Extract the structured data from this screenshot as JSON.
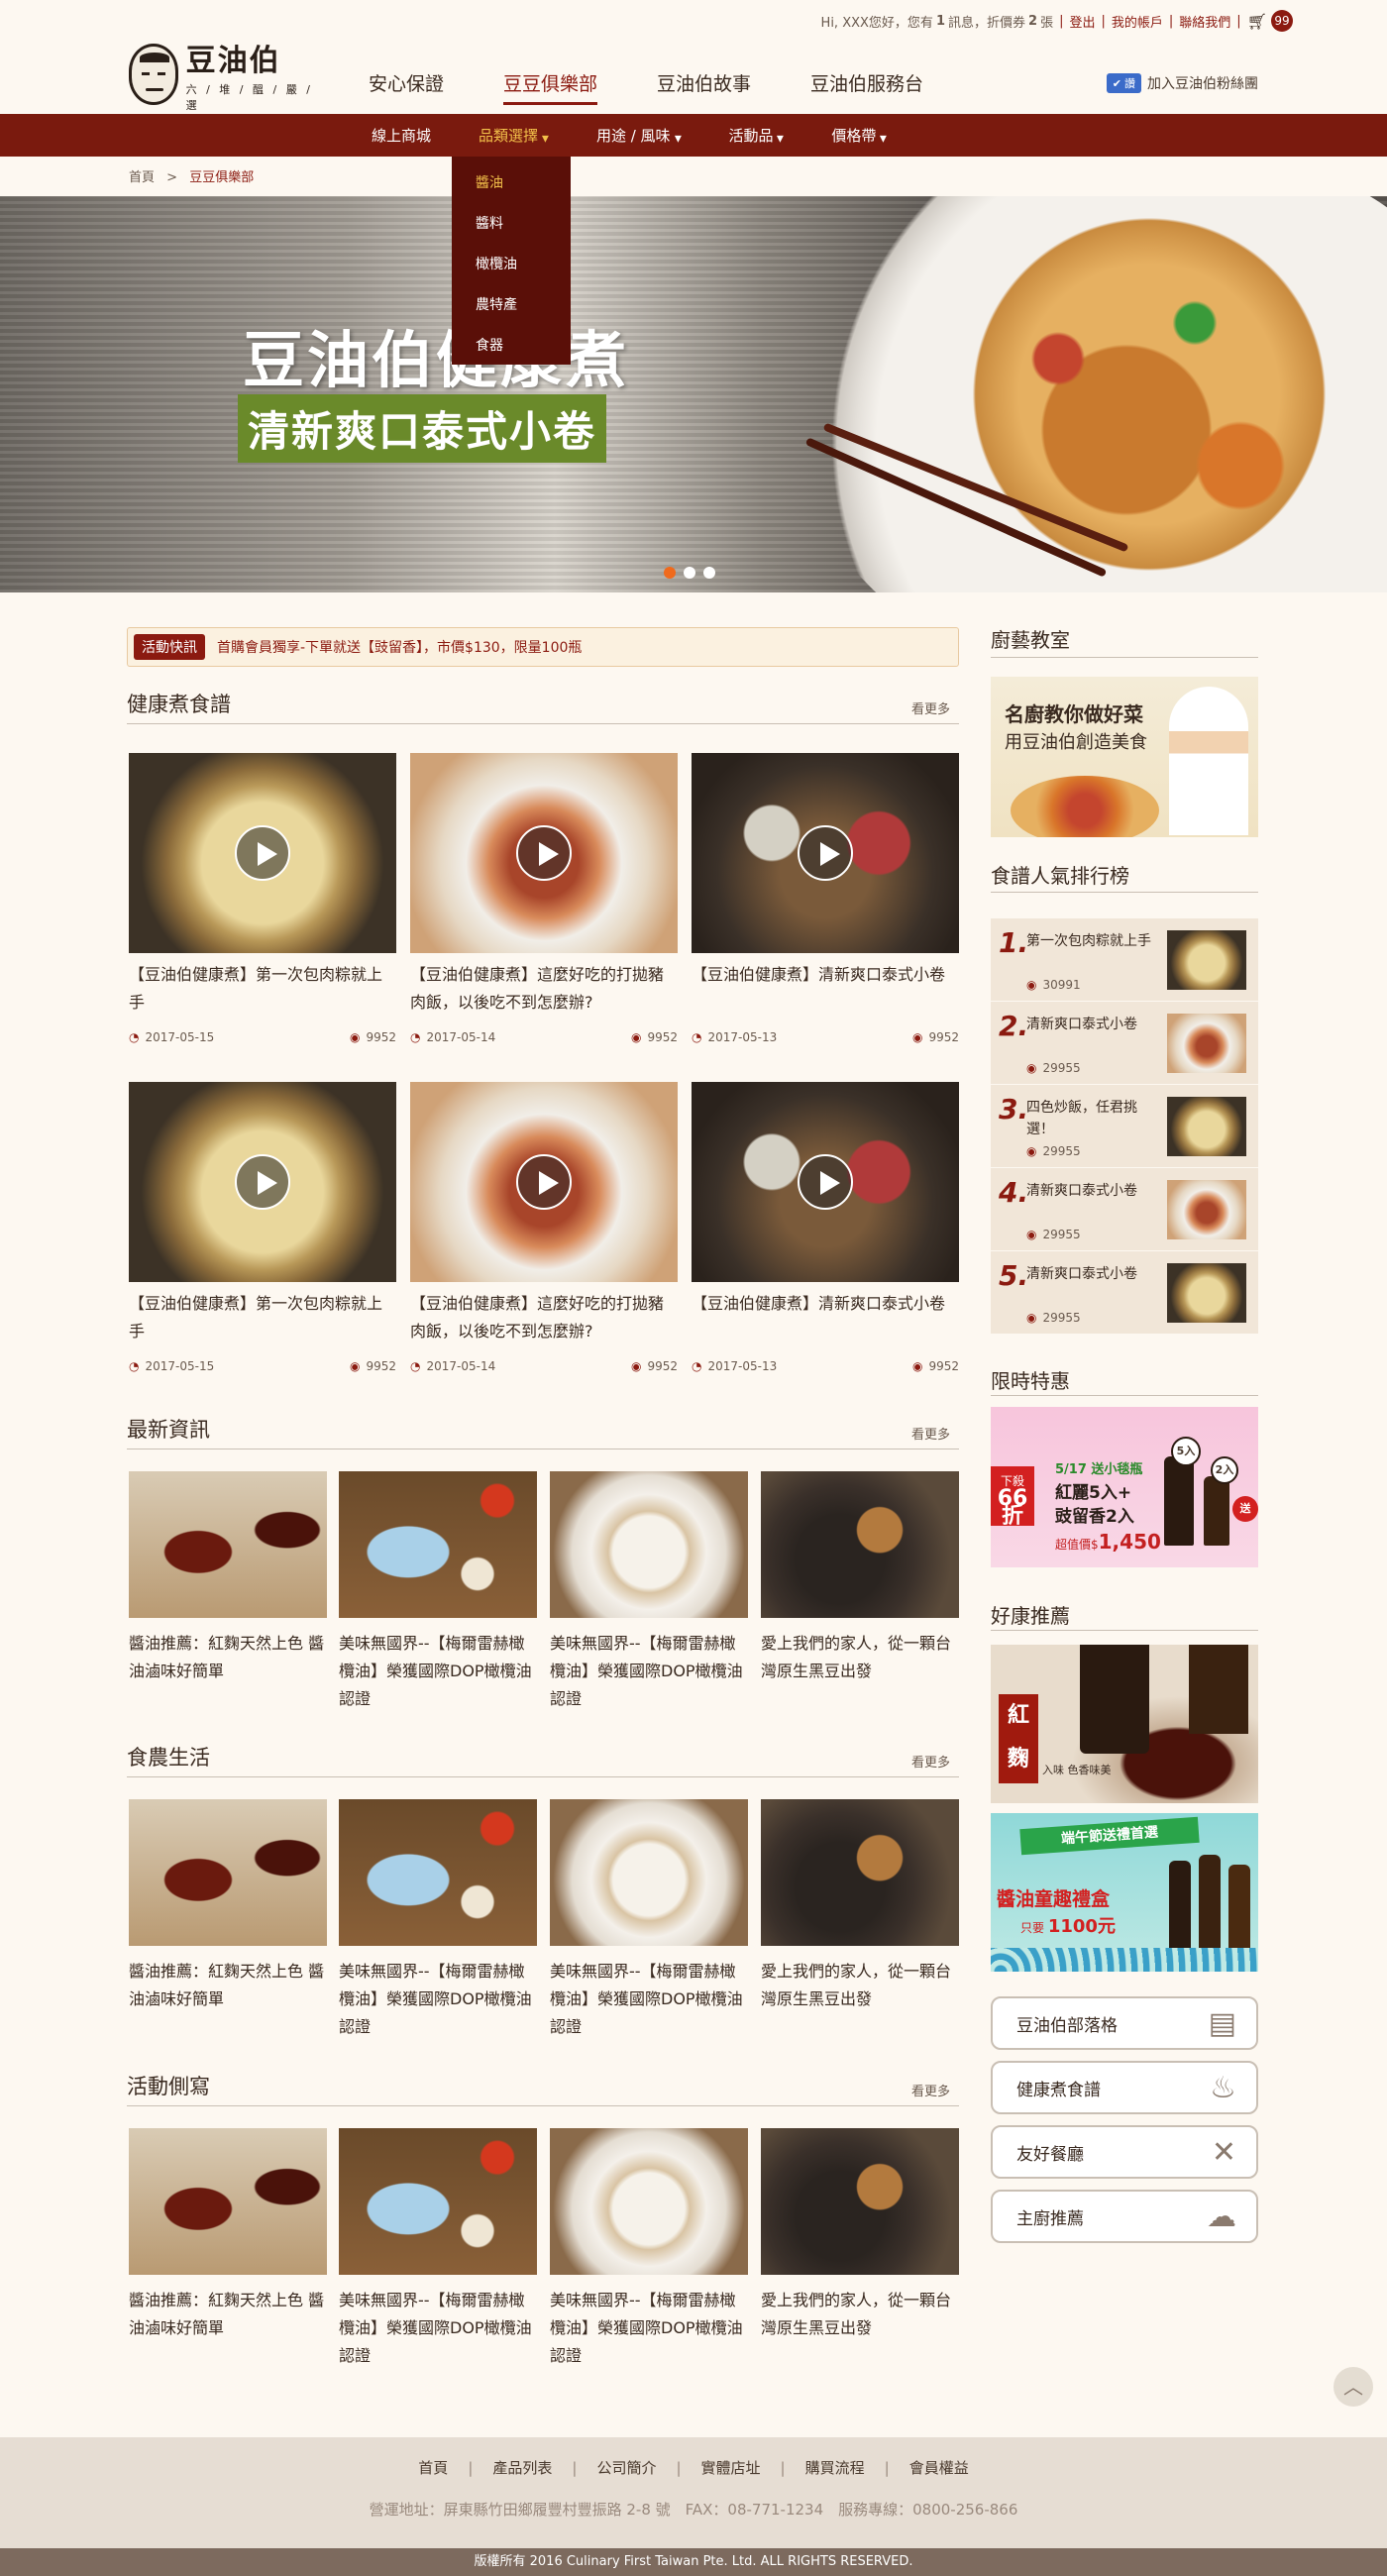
{
  "top_bar": {
    "greeting": "Hi, XXX您好，",
    "messages_prefix": "您有",
    "messages_count": "1",
    "messages_unit": "訊息，",
    "coupons_prefix": "折價券",
    "coupons_count": "2",
    "coupons_unit": "張",
    "logout": "登出",
    "account": "我的帳戶",
    "contact": "聯絡我們",
    "cart_count": "99"
  },
  "logo": {
    "name": "豆油伯",
    "tagline": "六 / 堆 / 醞 / 嚴 / 選"
  },
  "main_nav": [
    "安心保證",
    "豆豆俱樂部",
    "豆油伯故事",
    "豆油伯服務台"
  ],
  "main_nav_active": 1,
  "facebook": {
    "badge": "讚",
    "label": "加入豆油伯粉絲團"
  },
  "sub_nav": [
    {
      "label": "線上商城",
      "dropdown": false
    },
    {
      "label": "品類選擇",
      "dropdown": true
    },
    {
      "label": "用途 / 風味",
      "dropdown": true
    },
    {
      "label": "活動品",
      "dropdown": true
    },
    {
      "label": "價格帶",
      "dropdown": true
    }
  ],
  "dropdown_items": [
    "醬油",
    "醬料",
    "橄欖油",
    "農特產",
    "食器"
  ],
  "breadcrumb": {
    "home": "首頁",
    "separator": ">",
    "current": "豆豆俱樂部"
  },
  "hero": {
    "title": "豆油伯健康煮",
    "subtitle": "清新爽口泰式小卷",
    "slide_count": 3,
    "active_slide": 0
  },
  "promo": {
    "tag": "活動快訊",
    "text": "首購會員獨享-下單就送【豉留香】，市價$130，限量100瓶"
  },
  "sections": {
    "healthy_cooking": {
      "title": "健康煮食譜",
      "more": "看更多"
    },
    "news": {
      "title": "最新資訊",
      "more": "看更多"
    },
    "farm_life": {
      "title": "食農生活",
      "more": "看更多"
    },
    "events": {
      "title": "活動側寫",
      "more": "看更多"
    }
  },
  "videos": [
    {
      "title": "【豆油伯健康煮】第一次包肉粽就上手",
      "date": "2017-05-15",
      "views": "9952",
      "img": "zongzi"
    },
    {
      "title": "【豆油伯健康煮】這麼好吃的打拋豬肉飯，以後吃不到怎麼辦?",
      "date": "2017-05-14",
      "views": "9952",
      "img": "pork"
    },
    {
      "title": "【豆油伯健康煮】清新爽口泰式小卷",
      "date": "2017-05-13",
      "views": "9952",
      "img": "hotpot"
    },
    {
      "title": "【豆油伯健康煮】第一次包肉粽就上手",
      "date": "2017-05-15",
      "views": "9952",
      "img": "zongzi"
    },
    {
      "title": "【豆油伯健康煮】這麼好吃的打拋豬肉飯，以後吃不到怎麼辦?",
      "date": "2017-05-14",
      "views": "9952",
      "img": "pork"
    },
    {
      "title": "【豆油伯健康煮】清新爽口泰式小卷",
      "date": "2017-05-13",
      "views": "9952",
      "img": "hotpot"
    }
  ],
  "articles": [
    {
      "title": "醬油推薦：紅麴天然上色 醬油滷味好簡單"
    },
    {
      "title": "美味無國界--【梅爾雷赫橄欖油】榮獲國際DOP橄欖油認證"
    },
    {
      "title": "美味無國界--【梅爾雷赫橄欖油】榮獲國際DOP橄欖油認證"
    },
    {
      "title": "愛上我們的家人，從一顆台灣原生黑豆出發"
    }
  ],
  "sidebar": {
    "class_title": "廚藝教室",
    "chef_banner": {
      "line1": "名廚教你做好菜",
      "line2": "用豆油伯創造美食"
    },
    "ranking_title": "食譜人氣排行榜",
    "ranking": [
      {
        "rank": "1.",
        "title": "第一次包肉粽就上手",
        "views": "30991"
      },
      {
        "rank": "2.",
        "title": "清新爽口泰式小卷",
        "views": "29955"
      },
      {
        "rank": "3.",
        "title": "四色炒飯，任君挑選！",
        "views": "29955"
      },
      {
        "rank": "4.",
        "title": "清新爽口泰式小卷",
        "views": "29955"
      },
      {
        "rank": "5.",
        "title": "清新爽口泰式小卷",
        "views": "29955"
      }
    ],
    "sale_title": "限時特惠",
    "sale_banner": {
      "left_top": "下殺",
      "left_big": "66折",
      "line1": "5/17 送小毯瓶",
      "line2": "紅麗5入+",
      "line3": "豉留香2入",
      "price_label": "超值價$",
      "price": "1,450",
      "badge1": "5入",
      "badge2": "2入",
      "badge3": "送"
    },
    "recommend_title": "好康推薦",
    "koji_banner": {
      "tag": "紅麴",
      "sub": "入味 色香味美"
    },
    "gift_banner": {
      "ribbon": "端午節送禮首選",
      "title": "醬油童趣禮盒",
      "price_label": "只要",
      "price": "1100元"
    },
    "buttons": [
      {
        "label": "豆油伯部落格",
        "icon": "newspaper-icon",
        "glyph": "▤"
      },
      {
        "label": "健康煮食譜",
        "icon": "pot-icon",
        "glyph": "♨"
      },
      {
        "label": "友好餐廳",
        "icon": "fork-knife-icon",
        "glyph": "✕"
      },
      {
        "label": "主廚推薦",
        "icon": "chef-hat-icon",
        "glyph": "☁"
      }
    ]
  },
  "footer": {
    "links": [
      "首頁",
      "產品列表",
      "公司簡介",
      "實體店址",
      "購買流程",
      "會員權益"
    ],
    "address": "營運地址：屏東縣竹田鄉履豐村豐振路 2-8 號　FAX：08-771-1234　服務專線：0800-256-866",
    "copyright": "版權所有 2016 Culinary First Taiwan Pte. Ltd. ALL RIGHTS RESERVED."
  },
  "colors": {
    "brand": "#7a1a0e",
    "accent": "#8b1a10",
    "highlight": "#f2c04a",
    "background": "#fdf8f1"
  }
}
